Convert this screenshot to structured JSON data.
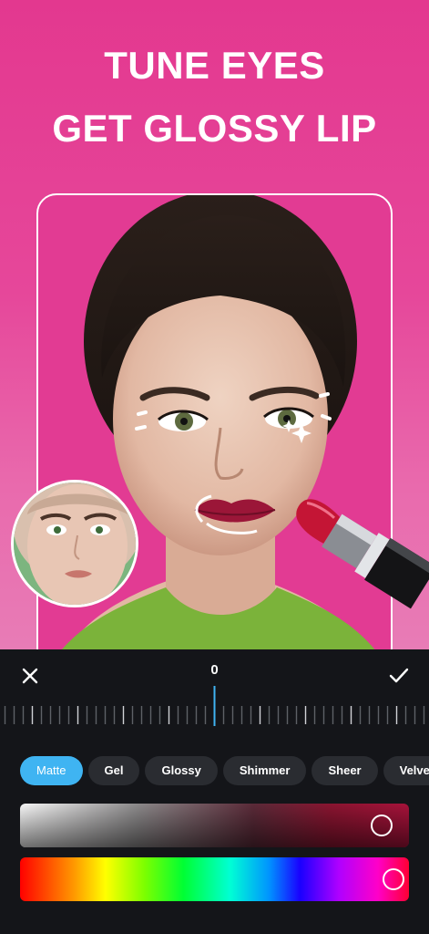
{
  "headline": {
    "line1": "TUNE EYES",
    "line2": "GET GLOSSY LIP"
  },
  "editor": {
    "value": "0",
    "close_icon": "close-icon",
    "confirm_icon": "check-icon",
    "finishes": [
      "Matte",
      "Gel",
      "Glossy",
      "Shimmer",
      "Sheer",
      "Velvet"
    ],
    "selected_finish": "Matte",
    "shade_slider_level": 0.93,
    "hue_slider_level": 0.96
  },
  "colors": {
    "accent": "#3fb4f2",
    "background_pink": "#e3388f",
    "panel": "#141519",
    "lip": "#9b1638"
  }
}
